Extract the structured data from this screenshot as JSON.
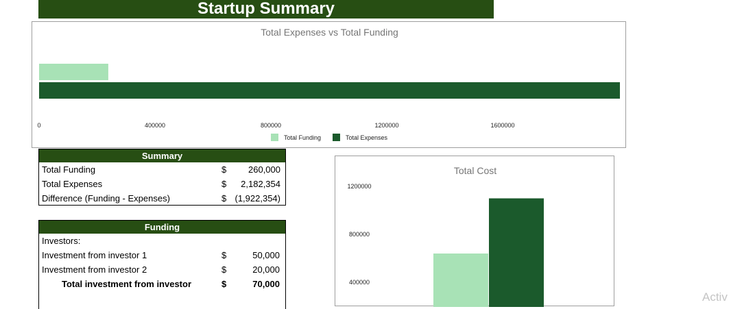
{
  "page": {
    "title": "Startup Summary"
  },
  "colors": {
    "header_bg": "#274e13",
    "funding": "#a8e2b6",
    "expenses": "#1b5a2c",
    "watermark": "#c4c4c4"
  },
  "chart_data": [
    {
      "type": "bar",
      "orientation": "horizontal",
      "title": "Total Expenses vs Total Funding",
      "series": [
        {
          "name": "Total Funding",
          "values": [
            260000
          ]
        },
        {
          "name": "Total Expenses",
          "values": [
            2182354
          ]
        }
      ],
      "xlim": [
        0,
        2000000
      ],
      "x_ticks": [
        "0",
        "400000",
        "800000",
        "1200000",
        "1600000"
      ],
      "grid": false,
      "legend": "bottom"
    },
    {
      "type": "bar",
      "title": "Total Cost",
      "series": [
        {
          "name": "Total Funding",
          "values": [
            640000
          ]
        },
        {
          "name": "Total Expenses",
          "values": [
            1100000
          ]
        }
      ],
      "y_ticks": [
        "1200000",
        "800000",
        "400000"
      ],
      "grid": false
    }
  ],
  "summary": {
    "header": "Summary",
    "rows": [
      {
        "label": "Total Funding",
        "currency": "$",
        "value": "260,000"
      },
      {
        "label": "Total Expenses",
        "currency": "$",
        "value": "2,182,354"
      },
      {
        "label": "Difference (Funding - Expenses)",
        "currency": "$",
        "value": "(1,922,354)"
      }
    ]
  },
  "funding": {
    "header": "Funding",
    "investors_label": "Investors:",
    "rows": [
      {
        "label": "Investment from investor 1",
        "currency": "$",
        "value": "50,000"
      },
      {
        "label": "Investment from investor 2",
        "currency": "$",
        "value": "20,000"
      }
    ],
    "total": {
      "label": "Total investment from investor",
      "currency": "$",
      "value": "70,000"
    }
  },
  "watermark": "Activ"
}
